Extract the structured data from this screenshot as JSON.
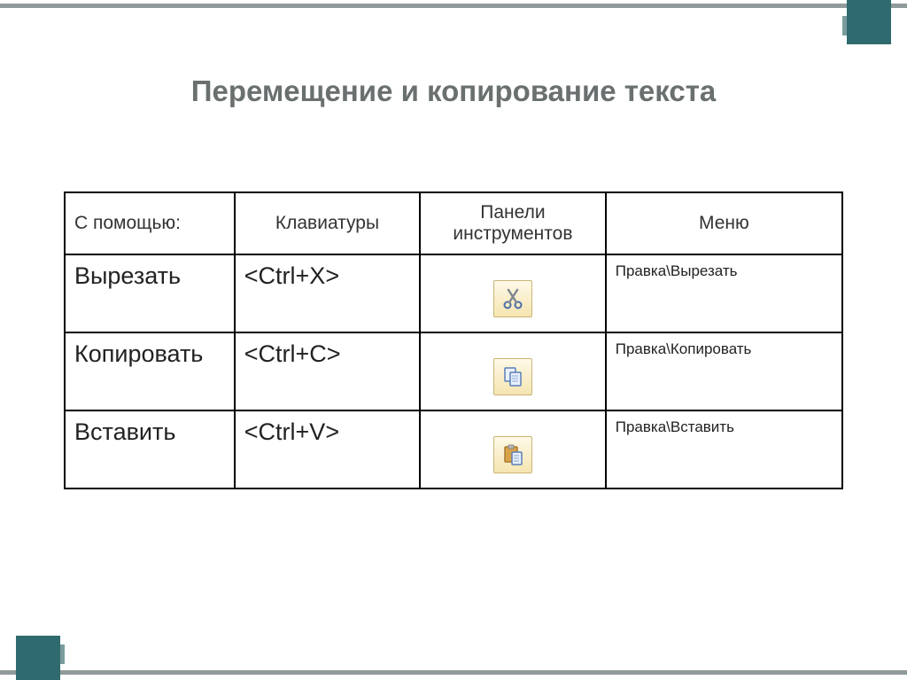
{
  "title": "Перемещение и копирование текста",
  "headers": {
    "col1": "С помощью:",
    "col2": "Клавиатуры",
    "col3": "Панели инструментов",
    "col4": "Меню"
  },
  "rows": [
    {
      "action": "Вырезать",
      "key": "<Ctrl+X>",
      "icon": "cut",
      "menu": "Правка\\Вырезать"
    },
    {
      "action": "Копировать",
      "key": "<Ctrl+C>",
      "icon": "copy",
      "menu": "Правка\\Копировать"
    },
    {
      "action": "Вставить",
      "key": "<Ctrl+V>",
      "icon": "paste",
      "menu": "Правка\\Вставить"
    }
  ]
}
